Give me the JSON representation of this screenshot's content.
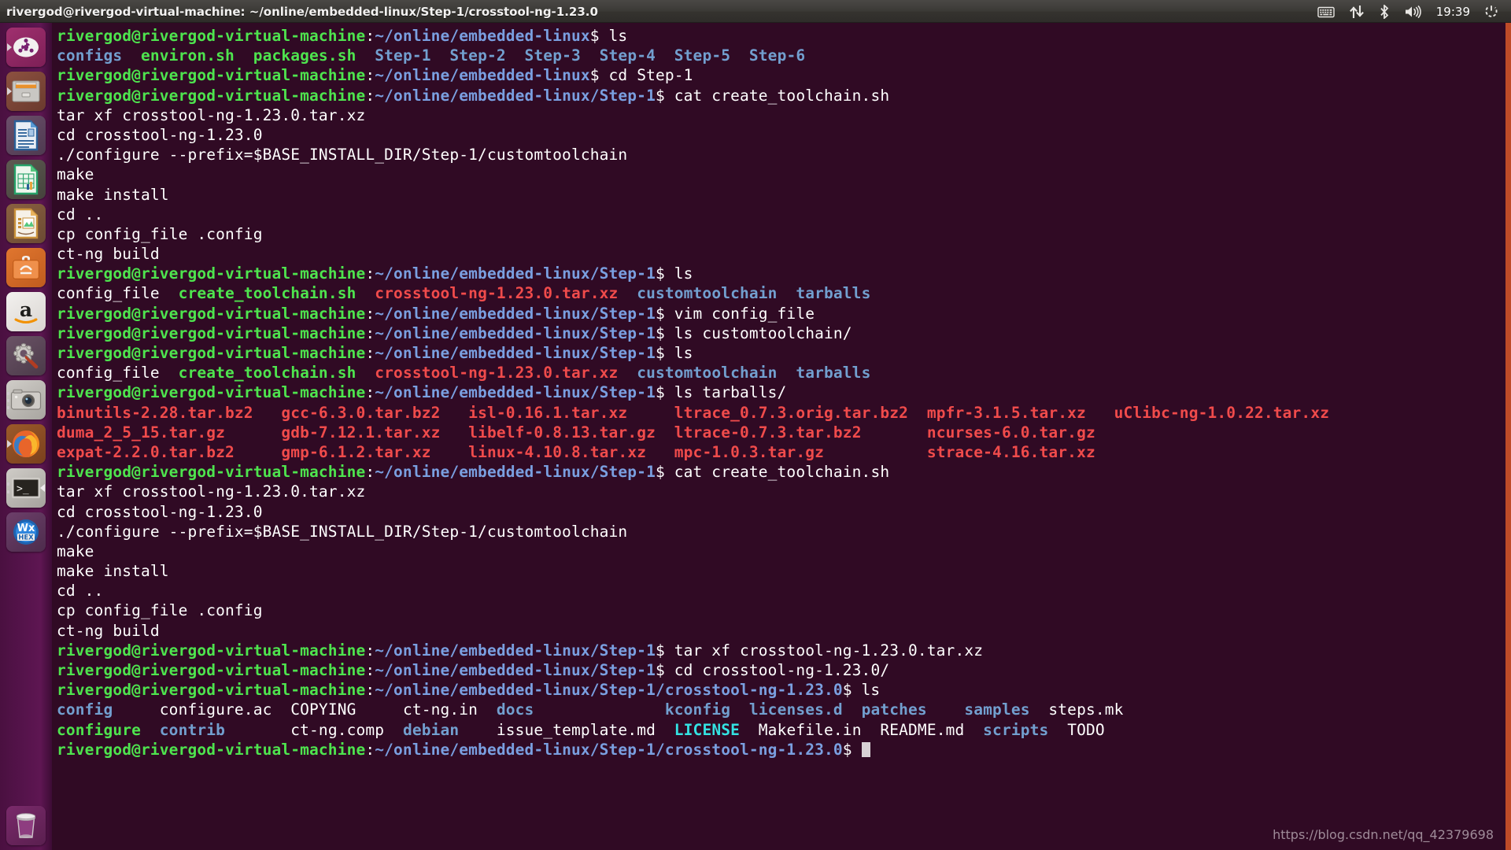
{
  "panel": {
    "title": "rivergod@rivergod-virtual-machine: ~/online/embedded-linux/Step-1/crosstool-ng-1.23.0",
    "clock": "19:39",
    "tray": [
      {
        "name": "keyboard-indicator-icon",
        "label": "keyboard"
      },
      {
        "name": "network-indicator-icon",
        "label": "network"
      },
      {
        "name": "bluetooth-indicator-icon",
        "label": "bluetooth"
      },
      {
        "name": "volume-indicator-icon",
        "label": "volume"
      },
      {
        "name": "session-indicator-icon",
        "label": "power"
      }
    ]
  },
  "launcher": {
    "items": [
      {
        "name": "launcher-item-dash",
        "label": "Ubuntu Dash Home"
      },
      {
        "name": "launcher-item-files",
        "label": "Files"
      },
      {
        "name": "launcher-item-libreoffice-writer",
        "label": "LibreOffice Writer"
      },
      {
        "name": "launcher-item-libreoffice-calc",
        "label": "LibreOffice Calc"
      },
      {
        "name": "launcher-item-libreoffice-impress",
        "label": "LibreOffice Impress"
      },
      {
        "name": "launcher-item-software-center",
        "label": "Ubuntu Software"
      },
      {
        "name": "launcher-item-amazon",
        "label": "Amazon"
      },
      {
        "name": "launcher-item-system-settings",
        "label": "System Settings"
      },
      {
        "name": "launcher-item-screenshot",
        "label": "Screenshot"
      },
      {
        "name": "launcher-item-firefox",
        "label": "Firefox"
      },
      {
        "name": "launcher-item-terminal",
        "label": "Terminal"
      },
      {
        "name": "launcher-item-wxwidgets",
        "label": "wxWidgets"
      }
    ],
    "trash": {
      "name": "launcher-item-trash",
      "label": "Trash"
    }
  },
  "terminal": {
    "background": "#300a24",
    "accent": "#bf4b28",
    "colors": {
      "prompt_user": "#4ee44e",
      "prompt_path": "#7a9fe0",
      "directory": "#729fcf",
      "executable": "#4ee44e",
      "archive": "#f04b4b",
      "symlink": "#34e2e2",
      "text": "#ffffff"
    },
    "prompt_user": "rivergod@rivergod-virtual-machine",
    "lines": [
      {
        "type": "prompt",
        "path": "~/online/embedded-linux",
        "command": " ls"
      },
      {
        "type": "files",
        "items": [
          {
            "t": "configs",
            "c": "dir"
          },
          {
            "t": "  ",
            "c": "w"
          },
          {
            "t": "environ.sh",
            "c": "exe"
          },
          {
            "t": "  ",
            "c": "w"
          },
          {
            "t": "packages.sh",
            "c": "exe"
          },
          {
            "t": "  ",
            "c": "w"
          },
          {
            "t": "Step-1",
            "c": "dir"
          },
          {
            "t": "  ",
            "c": "w"
          },
          {
            "t": "Step-2",
            "c": "dir"
          },
          {
            "t": "  ",
            "c": "w"
          },
          {
            "t": "Step-3",
            "c": "dir"
          },
          {
            "t": "  ",
            "c": "w"
          },
          {
            "t": "Step-4",
            "c": "dir"
          },
          {
            "t": "  ",
            "c": "w"
          },
          {
            "t": "Step-5",
            "c": "dir"
          },
          {
            "t": "  ",
            "c": "w"
          },
          {
            "t": "Step-6",
            "c": "dir"
          }
        ]
      },
      {
        "type": "prompt",
        "path": "~/online/embedded-linux",
        "command": " cd Step-1"
      },
      {
        "type": "prompt",
        "path": "~/online/embedded-linux/Step-1",
        "command": " cat create_toolchain.sh"
      },
      {
        "type": "plain",
        "text": "tar xf crosstool-ng-1.23.0.tar.xz"
      },
      {
        "type": "plain",
        "text": "cd crosstool-ng-1.23.0"
      },
      {
        "type": "plain",
        "text": "./configure --prefix=$BASE_INSTALL_DIR/Step-1/customtoolchain"
      },
      {
        "type": "plain",
        "text": "make"
      },
      {
        "type": "plain",
        "text": "make install"
      },
      {
        "type": "plain",
        "text": "cd .."
      },
      {
        "type": "plain",
        "text": "cp config_file .config"
      },
      {
        "type": "plain",
        "text": "ct-ng build"
      },
      {
        "type": "prompt",
        "path": "~/online/embedded-linux/Step-1",
        "command": " ls"
      },
      {
        "type": "files",
        "items": [
          {
            "t": "config_file",
            "c": "w"
          },
          {
            "t": "  ",
            "c": "w"
          },
          {
            "t": "create_toolchain.sh",
            "c": "exe"
          },
          {
            "t": "  ",
            "c": "w"
          },
          {
            "t": "crosstool-ng-1.23.0.tar.xz",
            "c": "arc"
          },
          {
            "t": "  ",
            "c": "w"
          },
          {
            "t": "customtoolchain",
            "c": "dir"
          },
          {
            "t": "  ",
            "c": "w"
          },
          {
            "t": "tarballs",
            "c": "dir"
          }
        ]
      },
      {
        "type": "prompt",
        "path": "~/online/embedded-linux/Step-1",
        "command": " vim config_file"
      },
      {
        "type": "prompt",
        "path": "~/online/embedded-linux/Step-1",
        "command": " ls customtoolchain/"
      },
      {
        "type": "prompt",
        "path": "~/online/embedded-linux/Step-1",
        "command": " ls"
      },
      {
        "type": "files",
        "items": [
          {
            "t": "config_file",
            "c": "w"
          },
          {
            "t": "  ",
            "c": "w"
          },
          {
            "t": "create_toolchain.sh",
            "c": "exe"
          },
          {
            "t": "  ",
            "c": "w"
          },
          {
            "t": "crosstool-ng-1.23.0.tar.xz",
            "c": "arc"
          },
          {
            "t": "  ",
            "c": "w"
          },
          {
            "t": "customtoolchain",
            "c": "dir"
          },
          {
            "t": "  ",
            "c": "w"
          },
          {
            "t": "tarballs",
            "c": "dir"
          }
        ]
      },
      {
        "type": "prompt",
        "path": "~/online/embedded-linux/Step-1",
        "command": " ls tarballs/"
      },
      {
        "type": "files",
        "items": [
          {
            "t": "binutils-2.28.tar.bz2",
            "c": "arc"
          },
          {
            "t": "   ",
            "c": "w"
          },
          {
            "t": "gcc-6.3.0.tar.bz2",
            "c": "arc"
          },
          {
            "t": "   ",
            "c": "w"
          },
          {
            "t": "isl-0.16.1.tar.xz",
            "c": "arc"
          },
          {
            "t": "     ",
            "c": "w"
          },
          {
            "t": "ltrace_0.7.3.orig.tar.bz2",
            "c": "arc"
          },
          {
            "t": "  ",
            "c": "w"
          },
          {
            "t": "mpfr-3.1.5.tar.xz",
            "c": "arc"
          },
          {
            "t": "   ",
            "c": "w"
          },
          {
            "t": "uClibc-ng-1.0.22.tar.xz",
            "c": "arc"
          }
        ]
      },
      {
        "type": "files",
        "items": [
          {
            "t": "duma_2_5_15.tar.gz",
            "c": "arc"
          },
          {
            "t": "      ",
            "c": "w"
          },
          {
            "t": "gdb-7.12.1.tar.xz",
            "c": "arc"
          },
          {
            "t": "   ",
            "c": "w"
          },
          {
            "t": "libelf-0.8.13.tar.gz",
            "c": "arc"
          },
          {
            "t": "  ",
            "c": "w"
          },
          {
            "t": "ltrace-0.7.3.tar.bz2",
            "c": "arc"
          },
          {
            "t": "       ",
            "c": "w"
          },
          {
            "t": "ncurses-6.0.tar.gz",
            "c": "arc"
          }
        ]
      },
      {
        "type": "files",
        "items": [
          {
            "t": "expat-2.2.0.tar.bz2",
            "c": "arc"
          },
          {
            "t": "     ",
            "c": "w"
          },
          {
            "t": "gmp-6.1.2.tar.xz",
            "c": "arc"
          },
          {
            "t": "    ",
            "c": "w"
          },
          {
            "t": "linux-4.10.8.tar.xz",
            "c": "arc"
          },
          {
            "t": "   ",
            "c": "w"
          },
          {
            "t": "mpc-1.0.3.tar.gz",
            "c": "arc"
          },
          {
            "t": "           ",
            "c": "w"
          },
          {
            "t": "strace-4.16.tar.xz",
            "c": "arc"
          }
        ]
      },
      {
        "type": "prompt",
        "path": "~/online/embedded-linux/Step-1",
        "command": " cat create_toolchain.sh"
      },
      {
        "type": "plain",
        "text": "tar xf crosstool-ng-1.23.0.tar.xz"
      },
      {
        "type": "plain",
        "text": "cd crosstool-ng-1.23.0"
      },
      {
        "type": "plain",
        "text": "./configure --prefix=$BASE_INSTALL_DIR/Step-1/customtoolchain"
      },
      {
        "type": "plain",
        "text": "make"
      },
      {
        "type": "plain",
        "text": "make install"
      },
      {
        "type": "plain",
        "text": "cd .."
      },
      {
        "type": "plain",
        "text": "cp config_file .config"
      },
      {
        "type": "plain",
        "text": "ct-ng build"
      },
      {
        "type": "prompt",
        "path": "~/online/embedded-linux/Step-1",
        "command": " tar xf crosstool-ng-1.23.0.tar.xz"
      },
      {
        "type": "prompt",
        "path": "~/online/embedded-linux/Step-1",
        "command": " cd crosstool-ng-1.23.0/"
      },
      {
        "type": "prompt",
        "path": "~/online/embedded-linux/Step-1/crosstool-ng-1.23.0",
        "command": " ls"
      },
      {
        "type": "files",
        "items": [
          {
            "t": "config",
            "c": "dir"
          },
          {
            "t": "     ",
            "c": "w"
          },
          {
            "t": "configure.ac",
            "c": "w"
          },
          {
            "t": "  ",
            "c": "w"
          },
          {
            "t": "COPYING",
            "c": "w"
          },
          {
            "t": "     ",
            "c": "w"
          },
          {
            "t": "ct-ng.in",
            "c": "w"
          },
          {
            "t": "  ",
            "c": "w"
          },
          {
            "t": "docs",
            "c": "dir"
          },
          {
            "t": "              ",
            "c": "w"
          },
          {
            "t": "kconfig",
            "c": "dir"
          },
          {
            "t": "  ",
            "c": "w"
          },
          {
            "t": "licenses.d",
            "c": "dir"
          },
          {
            "t": "  ",
            "c": "w"
          },
          {
            "t": "patches",
            "c": "dir"
          },
          {
            "t": "    ",
            "c": "w"
          },
          {
            "t": "samples",
            "c": "dir"
          },
          {
            "t": "  ",
            "c": "w"
          },
          {
            "t": "steps.mk",
            "c": "w"
          }
        ]
      },
      {
        "type": "files",
        "items": [
          {
            "t": "configure",
            "c": "exe"
          },
          {
            "t": "  ",
            "c": "w"
          },
          {
            "t": "contrib",
            "c": "dir"
          },
          {
            "t": "       ",
            "c": "w"
          },
          {
            "t": "ct-ng.comp",
            "c": "w"
          },
          {
            "t": "  ",
            "c": "w"
          },
          {
            "t": "debian",
            "c": "dir"
          },
          {
            "t": "    ",
            "c": "w"
          },
          {
            "t": "issue_template.md",
            "c": "w"
          },
          {
            "t": "  ",
            "c": "w"
          },
          {
            "t": "LICENSE",
            "c": "lnk"
          },
          {
            "t": "  ",
            "c": "w"
          },
          {
            "t": "Makefile.in",
            "c": "w"
          },
          {
            "t": "  ",
            "c": "w"
          },
          {
            "t": "README.md",
            "c": "w"
          },
          {
            "t": "  ",
            "c": "w"
          },
          {
            "t": "scripts",
            "c": "dir"
          },
          {
            "t": "  ",
            "c": "w"
          },
          {
            "t": "TODO",
            "c": "w"
          }
        ]
      },
      {
        "type": "prompt-cursor",
        "path": "~/online/embedded-linux/Step-1/crosstool-ng-1.23.0",
        "command": " "
      }
    ]
  },
  "watermark": "https://blog.csdn.net/qq_42379698"
}
